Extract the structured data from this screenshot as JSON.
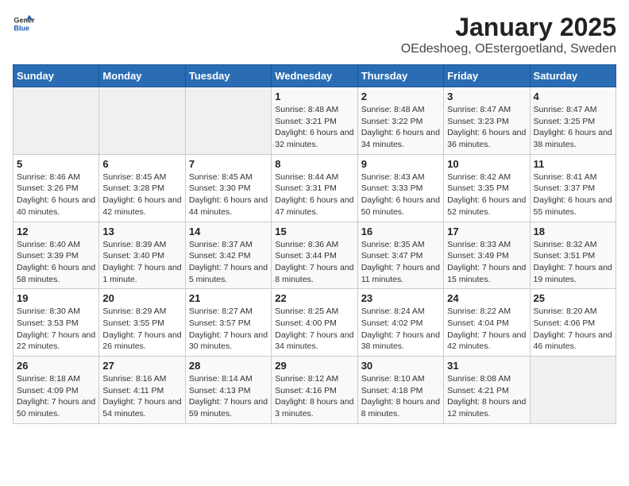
{
  "header": {
    "logo_general": "General",
    "logo_blue": "Blue",
    "title": "January 2025",
    "subtitle": "OEdeshoeg, OEstergoetland, Sweden"
  },
  "weekdays": [
    "Sunday",
    "Monday",
    "Tuesday",
    "Wednesday",
    "Thursday",
    "Friday",
    "Saturday"
  ],
  "weeks": [
    [
      {
        "day": "",
        "info": ""
      },
      {
        "day": "",
        "info": ""
      },
      {
        "day": "",
        "info": ""
      },
      {
        "day": "1",
        "info": "Sunrise: 8:48 AM\nSunset: 3:21 PM\nDaylight: 6 hours and 32 minutes."
      },
      {
        "day": "2",
        "info": "Sunrise: 8:48 AM\nSunset: 3:22 PM\nDaylight: 6 hours and 34 minutes."
      },
      {
        "day": "3",
        "info": "Sunrise: 8:47 AM\nSunset: 3:23 PM\nDaylight: 6 hours and 36 minutes."
      },
      {
        "day": "4",
        "info": "Sunrise: 8:47 AM\nSunset: 3:25 PM\nDaylight: 6 hours and 38 minutes."
      }
    ],
    [
      {
        "day": "5",
        "info": "Sunrise: 8:46 AM\nSunset: 3:26 PM\nDaylight: 6 hours and 40 minutes."
      },
      {
        "day": "6",
        "info": "Sunrise: 8:45 AM\nSunset: 3:28 PM\nDaylight: 6 hours and 42 minutes."
      },
      {
        "day": "7",
        "info": "Sunrise: 8:45 AM\nSunset: 3:30 PM\nDaylight: 6 hours and 44 minutes."
      },
      {
        "day": "8",
        "info": "Sunrise: 8:44 AM\nSunset: 3:31 PM\nDaylight: 6 hours and 47 minutes."
      },
      {
        "day": "9",
        "info": "Sunrise: 8:43 AM\nSunset: 3:33 PM\nDaylight: 6 hours and 50 minutes."
      },
      {
        "day": "10",
        "info": "Sunrise: 8:42 AM\nSunset: 3:35 PM\nDaylight: 6 hours and 52 minutes."
      },
      {
        "day": "11",
        "info": "Sunrise: 8:41 AM\nSunset: 3:37 PM\nDaylight: 6 hours and 55 minutes."
      }
    ],
    [
      {
        "day": "12",
        "info": "Sunrise: 8:40 AM\nSunset: 3:39 PM\nDaylight: 6 hours and 58 minutes."
      },
      {
        "day": "13",
        "info": "Sunrise: 8:39 AM\nSunset: 3:40 PM\nDaylight: 7 hours and 1 minute."
      },
      {
        "day": "14",
        "info": "Sunrise: 8:37 AM\nSunset: 3:42 PM\nDaylight: 7 hours and 5 minutes."
      },
      {
        "day": "15",
        "info": "Sunrise: 8:36 AM\nSunset: 3:44 PM\nDaylight: 7 hours and 8 minutes."
      },
      {
        "day": "16",
        "info": "Sunrise: 8:35 AM\nSunset: 3:47 PM\nDaylight: 7 hours and 11 minutes."
      },
      {
        "day": "17",
        "info": "Sunrise: 8:33 AM\nSunset: 3:49 PM\nDaylight: 7 hours and 15 minutes."
      },
      {
        "day": "18",
        "info": "Sunrise: 8:32 AM\nSunset: 3:51 PM\nDaylight: 7 hours and 19 minutes."
      }
    ],
    [
      {
        "day": "19",
        "info": "Sunrise: 8:30 AM\nSunset: 3:53 PM\nDaylight: 7 hours and 22 minutes."
      },
      {
        "day": "20",
        "info": "Sunrise: 8:29 AM\nSunset: 3:55 PM\nDaylight: 7 hours and 26 minutes."
      },
      {
        "day": "21",
        "info": "Sunrise: 8:27 AM\nSunset: 3:57 PM\nDaylight: 7 hours and 30 minutes."
      },
      {
        "day": "22",
        "info": "Sunrise: 8:25 AM\nSunset: 4:00 PM\nDaylight: 7 hours and 34 minutes."
      },
      {
        "day": "23",
        "info": "Sunrise: 8:24 AM\nSunset: 4:02 PM\nDaylight: 7 hours and 38 minutes."
      },
      {
        "day": "24",
        "info": "Sunrise: 8:22 AM\nSunset: 4:04 PM\nDaylight: 7 hours and 42 minutes."
      },
      {
        "day": "25",
        "info": "Sunrise: 8:20 AM\nSunset: 4:06 PM\nDaylight: 7 hours and 46 minutes."
      }
    ],
    [
      {
        "day": "26",
        "info": "Sunrise: 8:18 AM\nSunset: 4:09 PM\nDaylight: 7 hours and 50 minutes."
      },
      {
        "day": "27",
        "info": "Sunrise: 8:16 AM\nSunset: 4:11 PM\nDaylight: 7 hours and 54 minutes."
      },
      {
        "day": "28",
        "info": "Sunrise: 8:14 AM\nSunset: 4:13 PM\nDaylight: 7 hours and 59 minutes."
      },
      {
        "day": "29",
        "info": "Sunrise: 8:12 AM\nSunset: 4:16 PM\nDaylight: 8 hours and 3 minutes."
      },
      {
        "day": "30",
        "info": "Sunrise: 8:10 AM\nSunset: 4:18 PM\nDaylight: 8 hours and 8 minutes."
      },
      {
        "day": "31",
        "info": "Sunrise: 8:08 AM\nSunset: 4:21 PM\nDaylight: 8 hours and 12 minutes."
      },
      {
        "day": "",
        "info": ""
      }
    ]
  ]
}
